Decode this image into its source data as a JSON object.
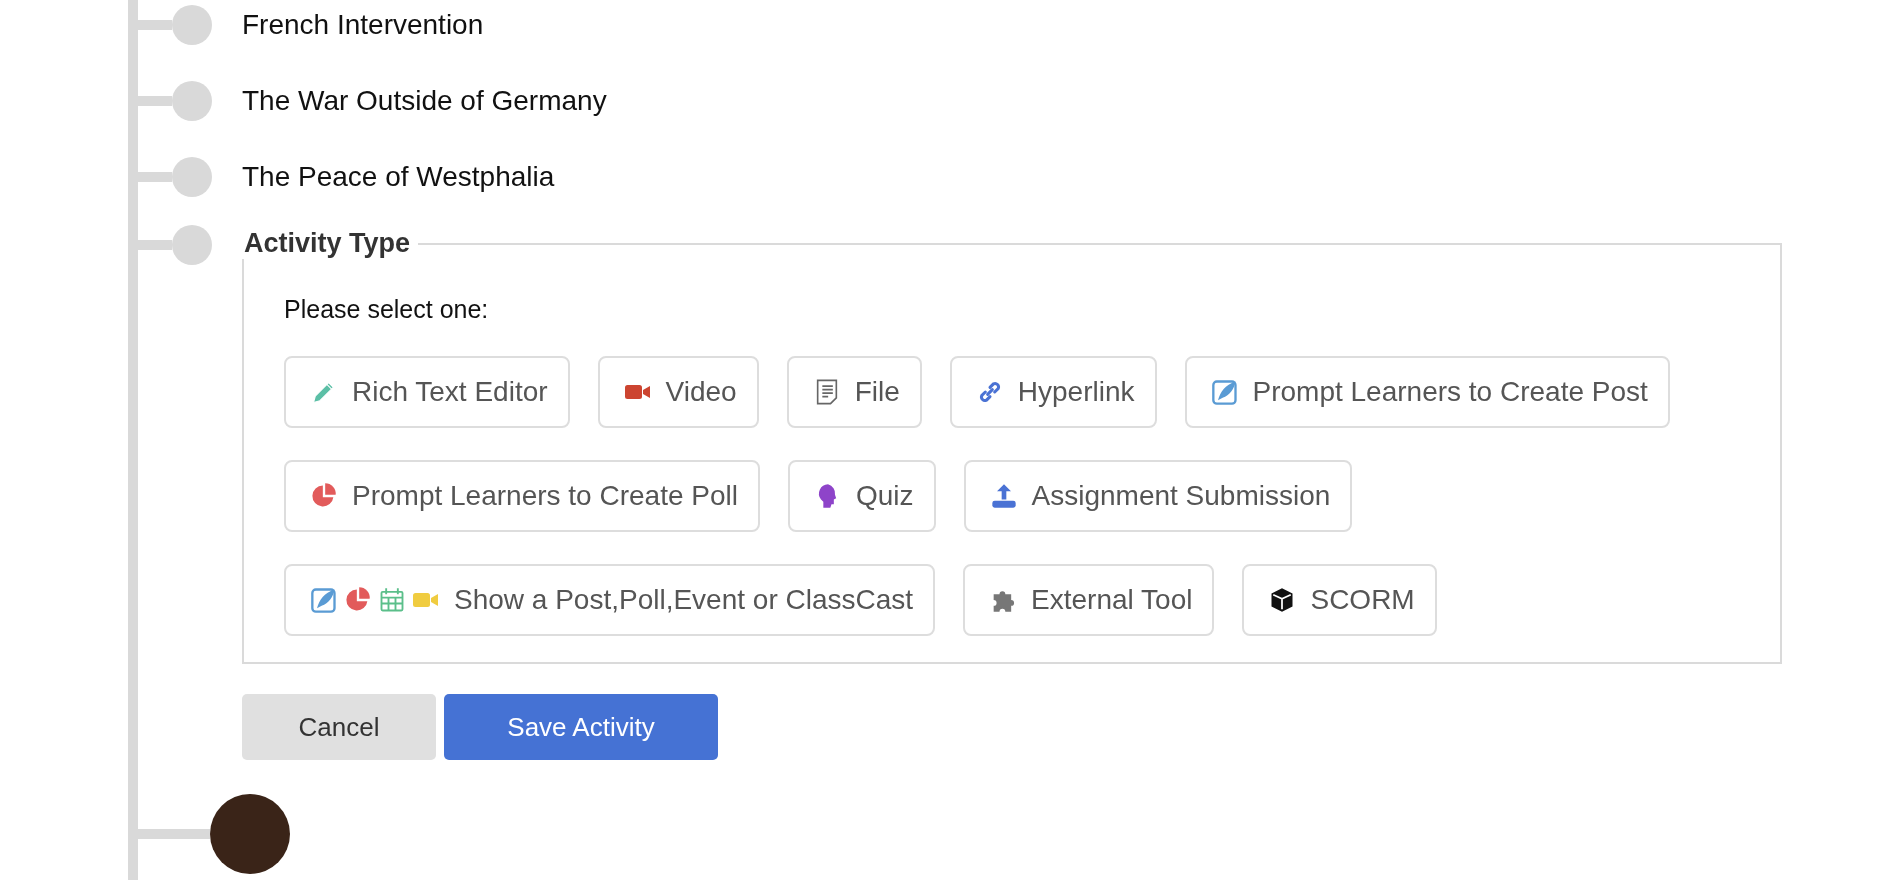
{
  "timeline": {
    "items": [
      {
        "title": "French Intervention"
      },
      {
        "title": "The War Outside of Germany"
      },
      {
        "title": "The Peace of Westphalia"
      }
    ]
  },
  "activity_type": {
    "legend": "Activity Type",
    "prompt": "Please select one:",
    "options": [
      {
        "kind": "pencil",
        "label": "Rich Text Editor"
      },
      {
        "kind": "video",
        "label": "Video"
      },
      {
        "kind": "file",
        "label": "File"
      },
      {
        "kind": "link",
        "label": "Hyperlink"
      },
      {
        "kind": "post",
        "label": "Prompt Learners to Create Post"
      },
      {
        "kind": "poll",
        "label": "Prompt Learners to Create Poll"
      },
      {
        "kind": "quiz",
        "label": "Quiz"
      },
      {
        "kind": "upload",
        "label": "Assignment Submission"
      },
      {
        "kind": "combo",
        "label": "Show a Post,Poll,Event or ClassCast"
      },
      {
        "kind": "puzzle",
        "label": "External Tool"
      },
      {
        "kind": "cube",
        "label": "SCORM"
      }
    ]
  },
  "actions": [
    {
      "kind": "secondary",
      "label": "Cancel"
    },
    {
      "kind": "primary",
      "label": "Save Activity"
    }
  ]
}
